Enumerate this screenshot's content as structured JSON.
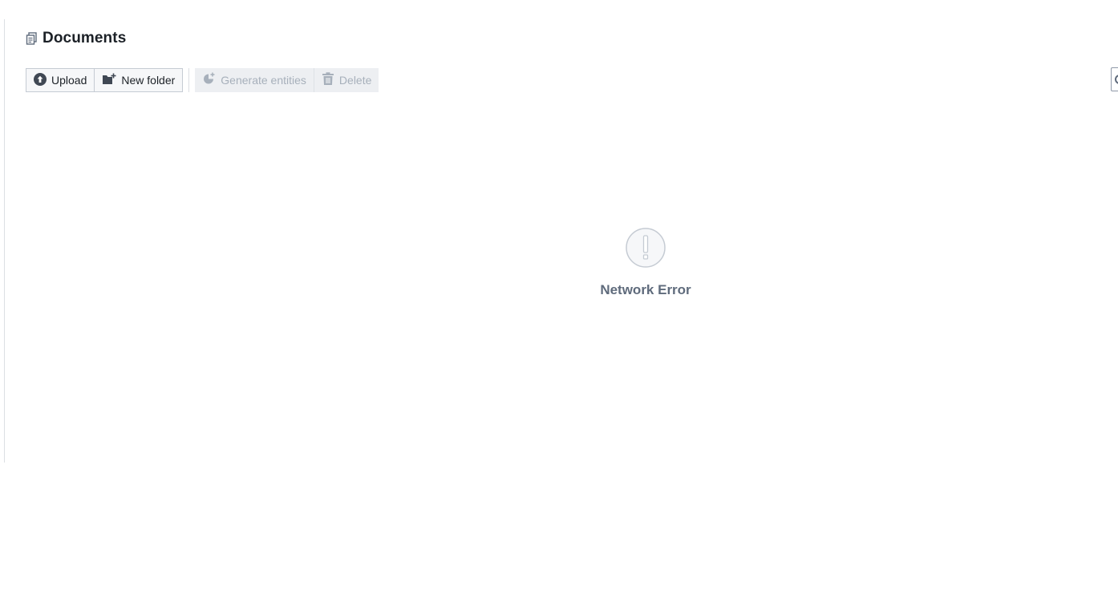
{
  "header": {
    "title": "Documents",
    "icon": "documents-icon"
  },
  "toolbar": {
    "upload_label": "Upload",
    "upload_icon": "arrow-up-circle-icon",
    "new_folder_label": "New folder",
    "new_folder_icon": "folder-new-icon",
    "generate_label": "Generate entities",
    "generate_icon": "generate-entities-icon",
    "delete_label": "Delete",
    "delete_icon": "trash-icon"
  },
  "empty_state": {
    "icon": "exclamation-circle-icon",
    "message": "Network Error"
  },
  "colors": {
    "muted_text": "#5f6b7c",
    "disabled_text": "#a7b0bb",
    "button_border": "#c5cbd3"
  }
}
